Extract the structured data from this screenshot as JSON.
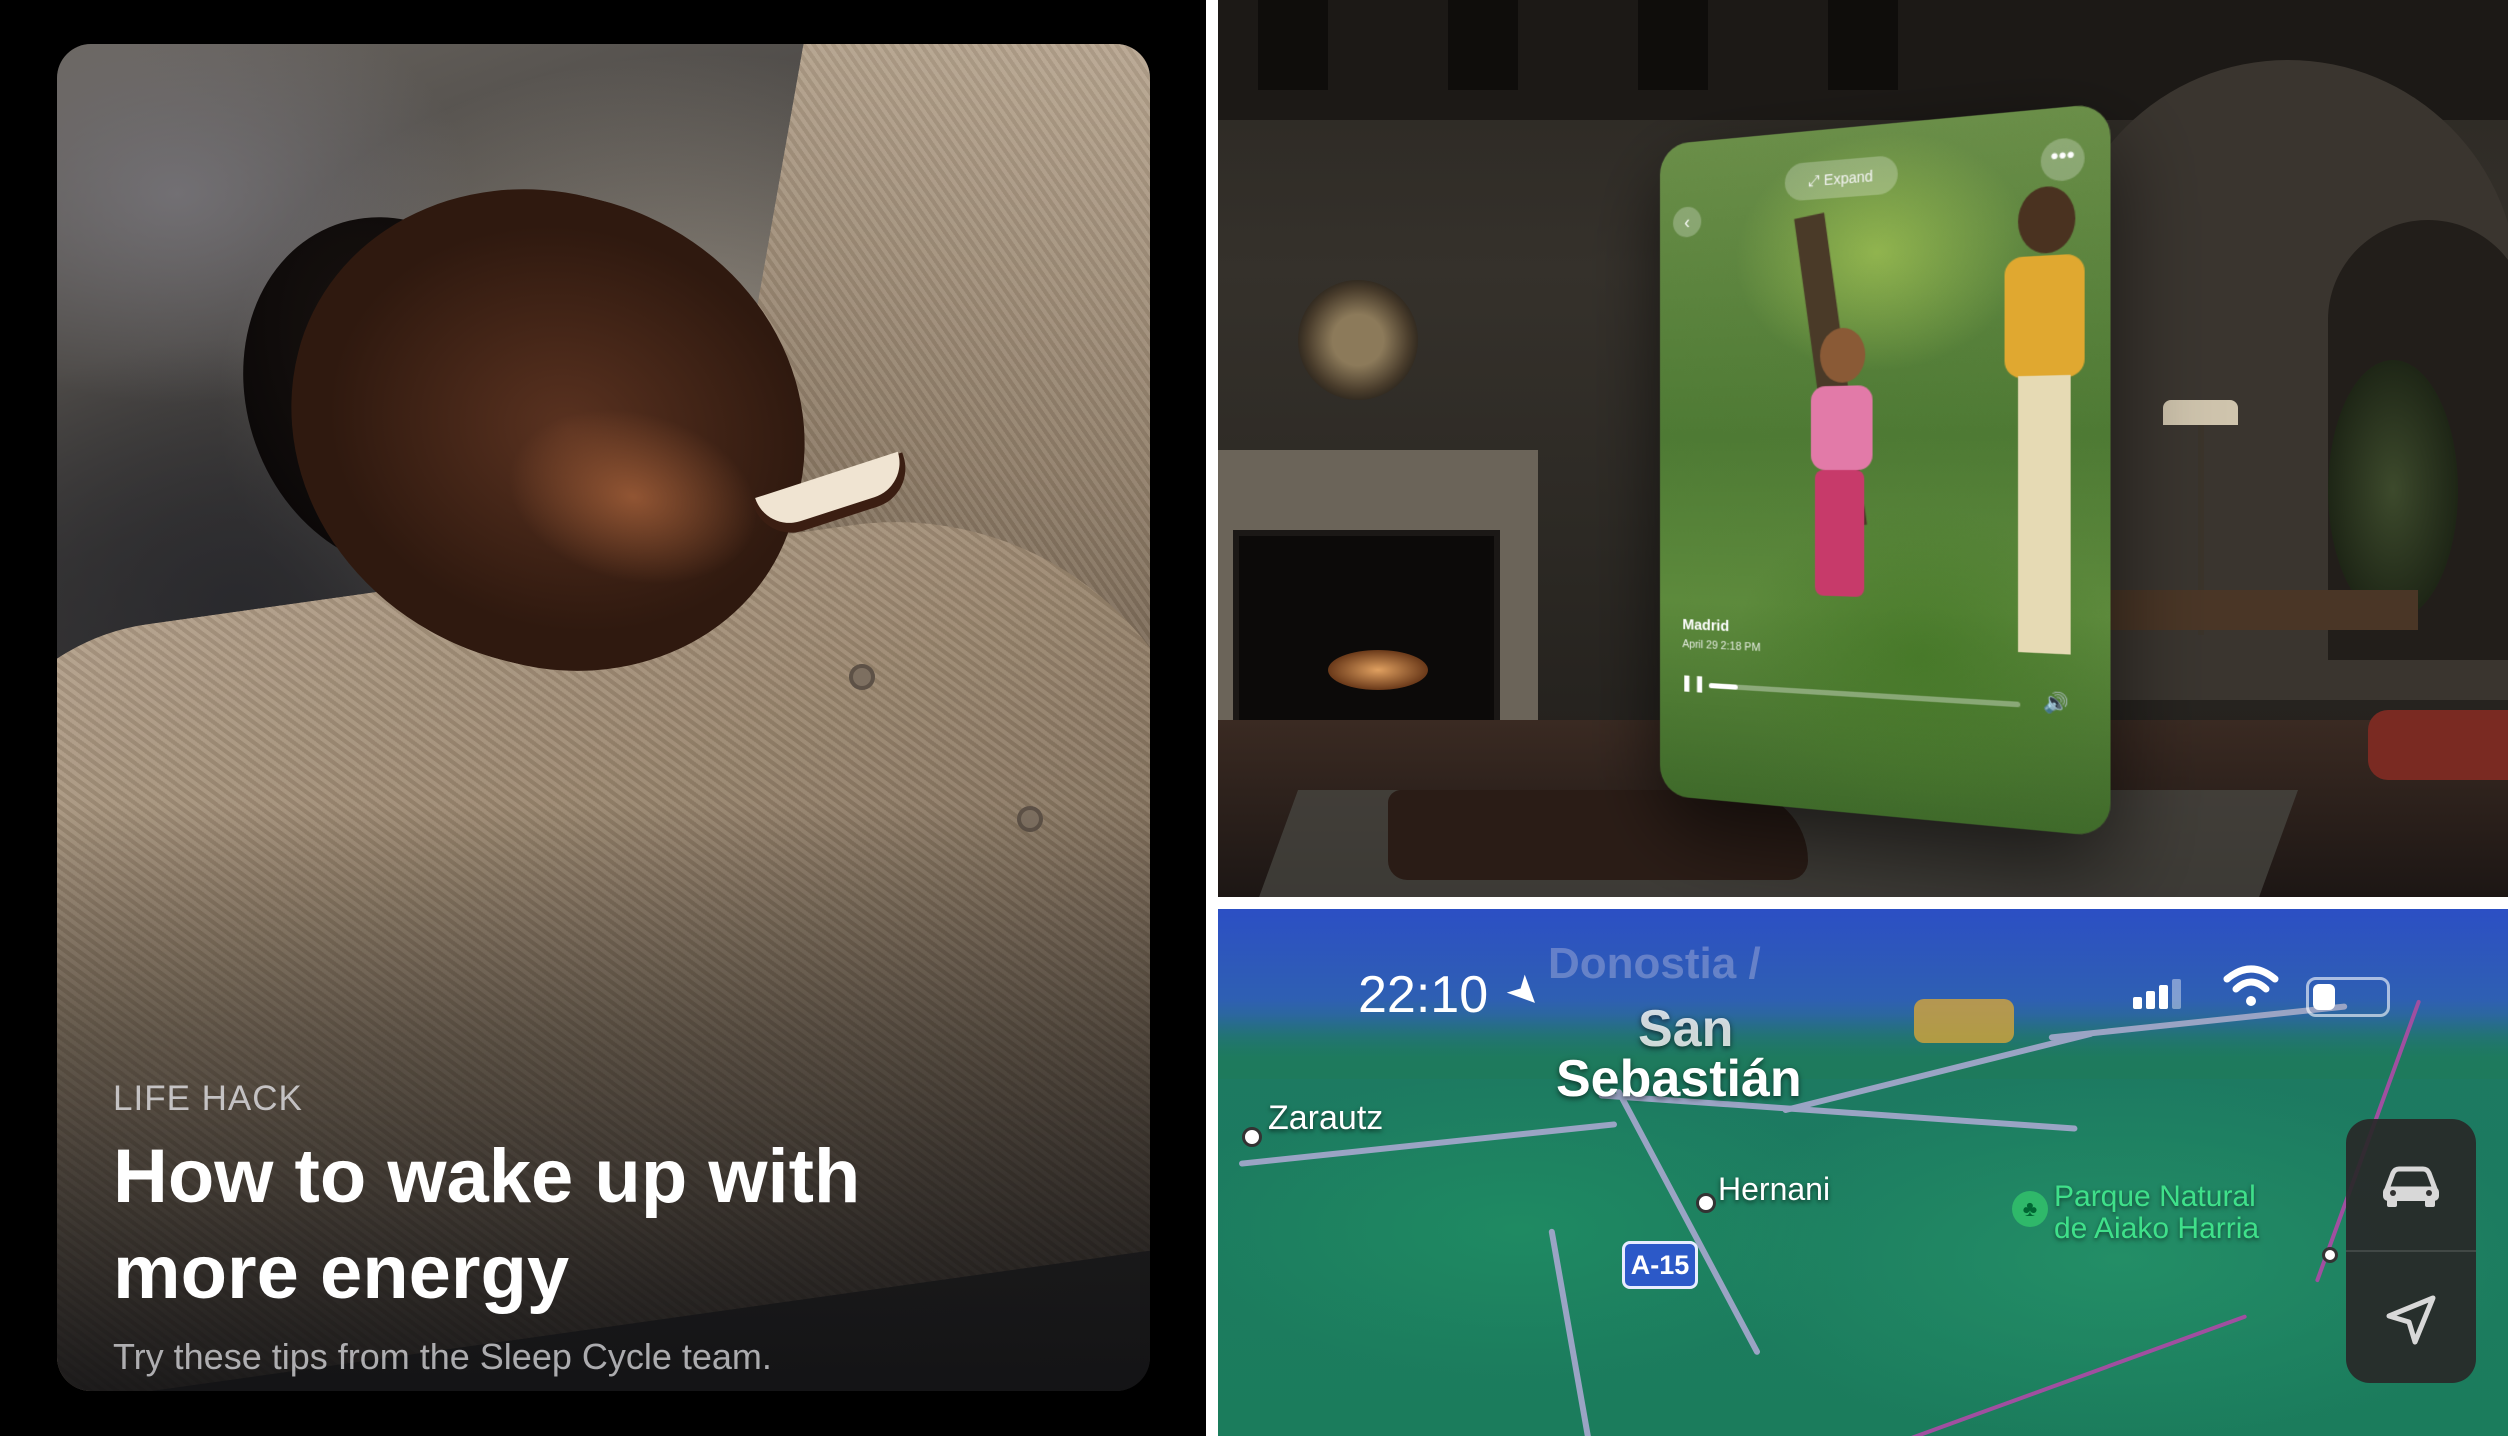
{
  "app_store_card": {
    "eyebrow": "LIFE HACK",
    "title": "How to wake up with more energy",
    "subtitle": "Try these tips from the Sleep Cycle team."
  },
  "vision_window": {
    "expand_label": "Expand",
    "more_glyph": "•••",
    "back_glyph": "‹",
    "place": "Madrid",
    "date": "April 29 2:18 PM",
    "pause_glyph": "❚❚",
    "volume_glyph": "🔊",
    "progress": 0.1
  },
  "map": {
    "status_time": "22:10",
    "battery_level": 0.35,
    "labels": {
      "donostia_faded": "Donostia /",
      "san": "San",
      "sebastian": "Sebastián",
      "zarautz": "Zarautz",
      "hernani": "Hernani",
      "park_line1": "Parque Natural",
      "park_line2": "de Aiako Harria",
      "road_shield": "A-15"
    },
    "icons": {
      "location": "location-arrow-icon",
      "signal": "cellular-signal-icon",
      "wifi": "wifi-icon",
      "battery": "battery-icon",
      "car": "car-icon",
      "navigate": "navigation-arrow-icon",
      "park": "tree-icon"
    },
    "colors": {
      "sea": "#2c4fc4",
      "land": "#1b7c5c",
      "park_text": "#3fe08a",
      "shield": "#2c59c8"
    }
  }
}
